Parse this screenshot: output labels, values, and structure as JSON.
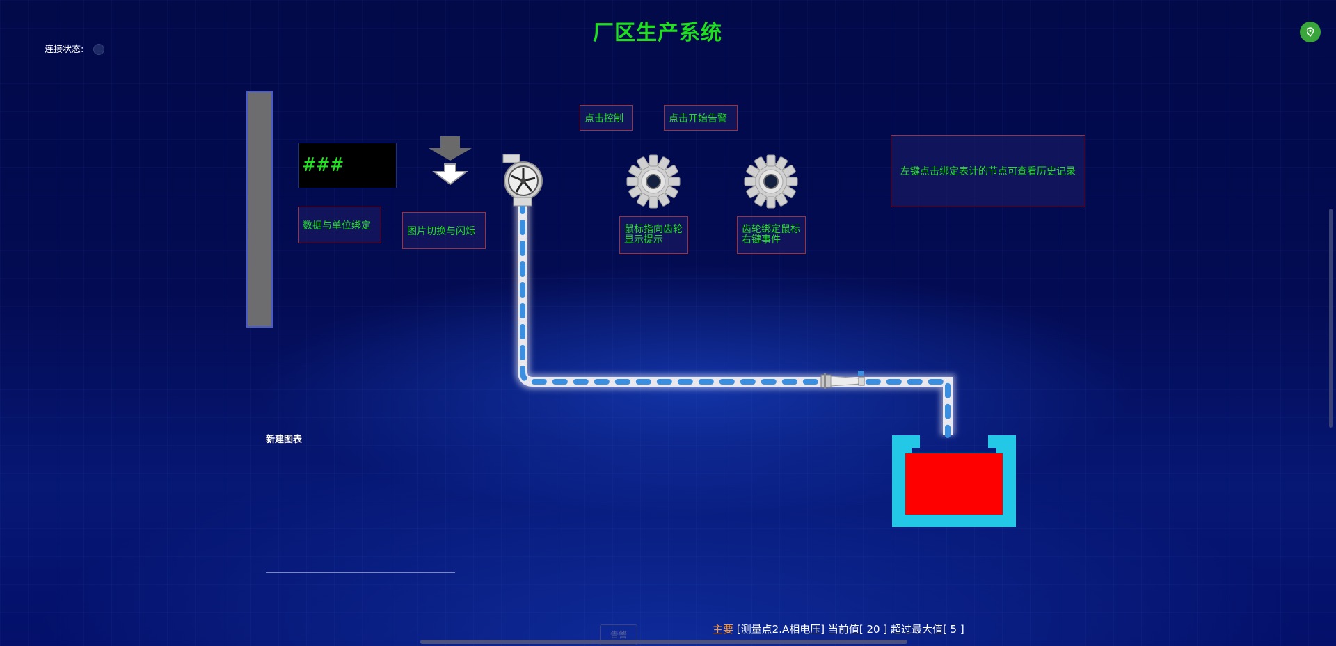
{
  "header": {
    "title": "厂区生产系统"
  },
  "connection": {
    "label": "连接状态:"
  },
  "display": {
    "value": "###"
  },
  "buttons": {
    "data_unit_bind": "数据与单位绑定",
    "image_switch_flash": "图片切换与闪烁",
    "click_control": "点击控制",
    "click_start_alarm": "点击开始告警",
    "gear_hover_hint": "鼠标指向齿轮显示提示",
    "gear_right_click": "齿轮绑定鼠标右键事件"
  },
  "info_panel": {
    "text": "左键点击绑定表计的节点可查看历史记录"
  },
  "chart": {
    "title": "新建图表"
  },
  "footer": {
    "alarm_tab": "告警",
    "alert_tag": "主要",
    "alert_message": "[测量点2.A相电压] 当前值[ 20 ] 超过最大值[ 5 ]"
  },
  "colors": {
    "accent_green": "#22e022",
    "tank_fill": "#ff0000",
    "tank_frame": "#22c8e6",
    "pipe_flow": "#3a8fe0",
    "alert_tag": "#ff9933"
  },
  "icons": [
    "map-pin-icon",
    "down-arrow-icon",
    "fan-pump-icon",
    "gear-icon",
    "valve-icon"
  ],
  "tank": {
    "fill_level": 0.67
  }
}
